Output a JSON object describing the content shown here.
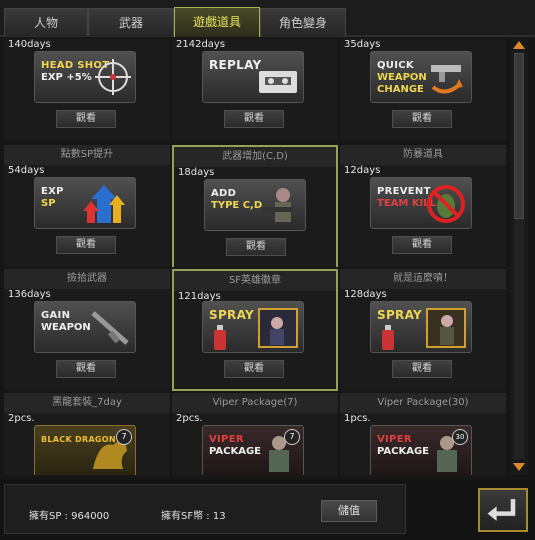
{
  "tabs": [
    {
      "label": "人物"
    },
    {
      "label": "武器"
    },
    {
      "label": "遊戲道具"
    },
    {
      "label": "角色變身"
    }
  ],
  "button_label": "觀看",
  "items": [
    {
      "header": "",
      "duration": "140days",
      "lines": [
        "HEAD SHOT",
        "EXP +5%",
        ""
      ],
      "icon": "crosshair-icon"
    },
    {
      "header": "",
      "duration": "2142days",
      "lines": [
        "REPLAY",
        "",
        ""
      ],
      "icon": "cassette-icon"
    },
    {
      "header": "",
      "duration": "35days",
      "lines": [
        "QUICK",
        "WEAPON",
        "CHANGE"
      ],
      "icon": "gun-swap-icon"
    },
    {
      "header": "點數SP提升",
      "duration": "54days",
      "lines": [
        "EXP",
        "SP",
        ""
      ],
      "icon": "up-arrows-icon"
    },
    {
      "header": "武器增加(C,D)",
      "duration": "18days",
      "lines": [
        "ADD",
        "TYPE C,D",
        ""
      ],
      "icon": "soldier-icon"
    },
    {
      "header": "防暴道具",
      "duration": "12days",
      "lines": [
        "PREVENT",
        "TEAM KILL",
        ""
      ],
      "icon": "no-grenade-icon"
    },
    {
      "header": "撿拾武器",
      "duration": "136days",
      "lines": [
        "GAIN",
        "WEAPON",
        ""
      ],
      "icon": "rifle-icon"
    },
    {
      "header": "SF英雄徽章",
      "duration": "121days",
      "lines": [
        "SPRAY",
        "",
        ""
      ],
      "icon": "spray-icon"
    },
    {
      "header": "就是這麼噴！",
      "duration": "128days",
      "lines": [
        "SPRAY",
        "",
        ""
      ],
      "icon": "spray-icon"
    },
    {
      "header": "黑龍套裝_7day",
      "duration": "2pcs.",
      "lines": [
        "BLACK DRAGON",
        "",
        ""
      ],
      "icon": "dragon-icon",
      "badge": "7"
    },
    {
      "header": "Viper Package(7)",
      "duration": "2pcs.",
      "lines": [
        "VIPER",
        "PACKAGE",
        ""
      ],
      "icon": "viper-icon",
      "badge": "7"
    },
    {
      "header": "Viper Package(30)",
      "duration": "1pcs.",
      "lines": [
        "VIPER",
        "PACKAGE",
        ""
      ],
      "icon": "viper-icon",
      "badge": "30"
    }
  ],
  "selected_index": 7,
  "footer": {
    "sp_text": "擁有SP : 964000",
    "sf_text": "擁有SF幣 : 13",
    "recharge_label": "儲值"
  },
  "colors": {
    "accent": "#93a256",
    "text_yellow": "#f0d650",
    "arrow_orange": "#d98a2a"
  }
}
